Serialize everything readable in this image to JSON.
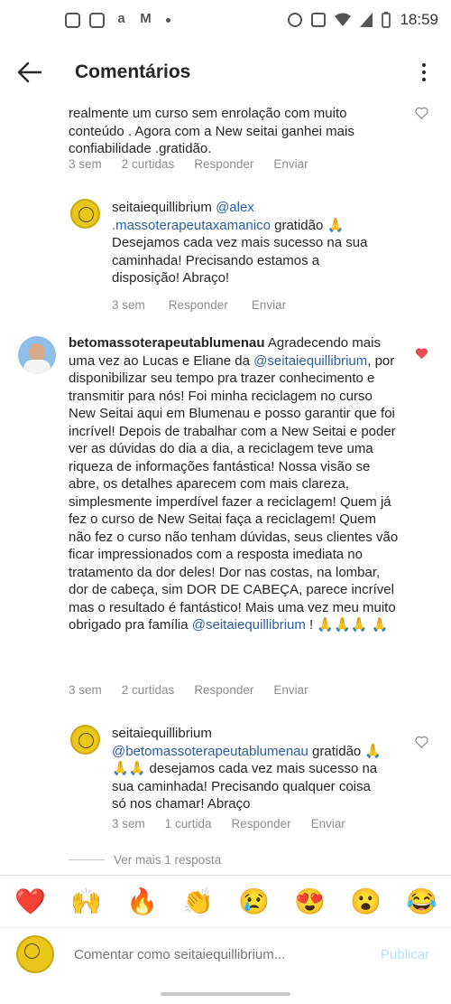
{
  "status_bar": {
    "time": "18:59"
  },
  "header": {
    "title": "Comentários"
  },
  "comments": [
    {
      "text": "realmente um curso sem enrolação com muito conteúdo . Agora com a New seitai ganhei mais confiabilidade .gratidão.",
      "time": "3 sem",
      "likes": "2 curtidas",
      "reply": "Responder",
      "send": "Enviar"
    },
    {
      "username": "seitaiequillibrium",
      "mention": "@alex .massoterapeutaxamanico",
      "text": " gratidão 🙏 Desejamos cada vez mais sucesso na sua caminhada! Precisando estamos a disposição! Abraço!",
      "time": "3 sem",
      "reply": "Responder",
      "send": "Enviar"
    },
    {
      "username": "betomassoterapeutablumenau",
      "text1": " Agradecendo mais uma vez ao Lucas e Eliane da ",
      "mention1": "@seitaiequillibrium",
      "text2": ", por disponibilizar seu tempo pra trazer conhecimento e transmitir para nós! Foi minha reciclagem no curso New Seitai aqui em Blumenau e posso garantir que foi incrível! Depois de trabalhar com a New Seitai e poder ver as dúvidas do dia a dia, a reciclagem teve uma riqueza de informações fantástica! Nossa visão se abre, os detalhes aparecem com mais clareza, simplesmente imperdível fazer a reciclagem! Quem já fez o curso de New Seitai faça a reciclagem! Quem não fez o curso não tenham dúvidas, seus clientes vão ficar impressionados com a resposta imediata no tratamento da dor deles! Dor nas costas, na lombar, dor de cabeça, sim DOR DE CABEÇA, parece incrível mas o resultado é fantástico! Mais uma vez meu muito obrigado pra família ",
      "mention2": "@seitaiequillibrium",
      "text3": " ! 🙏🙏🙏 🙏",
      "time": "3 sem",
      "likes": "2 curtidas",
      "reply": "Responder",
      "send": "Enviar"
    },
    {
      "username": "seitaiequillibrium",
      "mention": "@betomassoterapeutablumenau",
      "text": " gratidão 🙏🙏🙏 desejamos cada vez mais sucesso na sua caminhada! Precisando qualquer coisa só nos chamar! Abraço",
      "time": "3 sem",
      "likes": "1 curtida",
      "reply": "Responder",
      "send": "Enviar"
    }
  ],
  "view_more": "Ver mais 1 resposta",
  "reactions": [
    "❤️",
    "🙌",
    "🔥",
    "👏",
    "😢",
    "😍",
    "😮",
    "😂"
  ],
  "comment_input": {
    "placeholder": "Comentar como seitaiequillibrium...",
    "publish": "Publicar"
  },
  "colors": {
    "link": "#2b5ea4",
    "heart_liked": "#ed4956",
    "publish": "#b2dffc"
  }
}
